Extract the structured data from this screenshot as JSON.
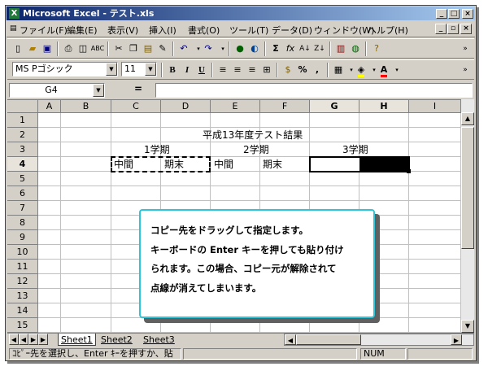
{
  "window": {
    "title": "Microsoft Excel - テスト.xls",
    "app_icon": "X"
  },
  "menu": [
    "ファイル(F)",
    "編集(E)",
    "表示(V)",
    "挿入(I)",
    "書式(O)",
    "ツール(T)",
    "データ(D)",
    "ウィンドウ(W)",
    "ヘルプ(H)"
  ],
  "format": {
    "font": "MS Pゴシック",
    "size": "11"
  },
  "formula_bar": {
    "name_box": "G4",
    "equals": "="
  },
  "columns": [
    "A",
    "B",
    "C",
    "D",
    "E",
    "F",
    "G",
    "H",
    "I"
  ],
  "rows": [
    "1",
    "2",
    "3",
    "4",
    "5",
    "6",
    "7",
    "8",
    "9",
    "10",
    "11",
    "12",
    "13",
    "14",
    "15"
  ],
  "cells": {
    "title": "平成13年度テスト結果",
    "term1": "1学期",
    "term2": "2学期",
    "term3": "3学期",
    "c4": "中間",
    "d4": "期末",
    "e4": "中間",
    "f4": "期末"
  },
  "sheets": [
    "Sheet1",
    "Sheet2",
    "Sheet3"
  ],
  "status": {
    "message": "ｺﾋﾟｰ先を選択し、Enter ｷｰを押すか、貼",
    "num": "NUM"
  },
  "callout": {
    "lines": [
      "コピー先をドラッグして指定します。",
      "キーボードの Enter キーを押しても貼り付け",
      "られます。この場合、コピー元が解除されて",
      "点線が消えてしまいます。"
    ]
  },
  "icons": [
    "new-icon",
    "open-icon",
    "save-icon",
    "print-icon",
    "preview-icon",
    "spell-icon",
    "cut-icon",
    "copy-icon",
    "paste-icon",
    "format-painter-icon",
    "undo-icon",
    "redo-icon",
    "hyperlink-icon",
    "web-icon",
    "sum-icon",
    "function-icon",
    "sort-asc-icon",
    "sort-desc-icon",
    "chart-icon",
    "map-icon",
    "help-icon"
  ],
  "colors": {
    "titlebar": "#0a246a",
    "selection": "#000000",
    "callout_border": "#2ec5d8",
    "font_color": "#ff0000",
    "fill_color": "#ffff00"
  }
}
